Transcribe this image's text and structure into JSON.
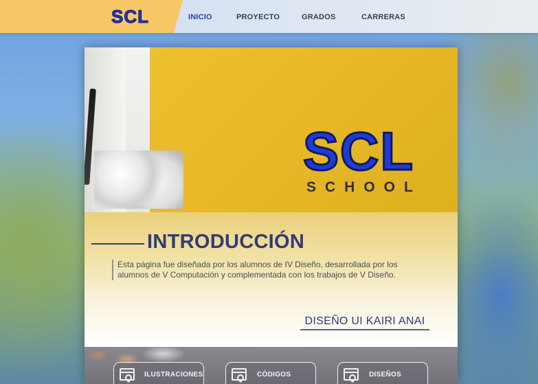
{
  "header": {
    "logo": "SCL",
    "nav": [
      {
        "label": "INICIO",
        "active": true
      },
      {
        "label": "PROYECTO",
        "active": false
      },
      {
        "label": "GRADOS",
        "active": false
      },
      {
        "label": "CARRERAS",
        "active": false
      }
    ]
  },
  "hero": {
    "logo_main": "SCL",
    "logo_sub": "SCHOOL"
  },
  "intro": {
    "title": "INTRODUCCIÓN",
    "text": "Esta página fue diseñada por los alumnos de IV Diseño, desarrollada por los alumnos de V Computación y complementada con los trabajos de V Diseño.",
    "credit": "DISEÑO UI KAIRI ANAI"
  },
  "categories": [
    {
      "label": "ILUSTRACIONES",
      "icon": "image-window-icon"
    },
    {
      "label": "CÓDIGOS",
      "icon": "code-window-icon"
    },
    {
      "label": "DISEÑOS",
      "icon": "design-window-icon"
    }
  ],
  "colors": {
    "accent_blue": "#2134c9",
    "logo_yellow": "#f7c765",
    "hero_yellow": "#efc232",
    "title_navy": "#323a78"
  }
}
